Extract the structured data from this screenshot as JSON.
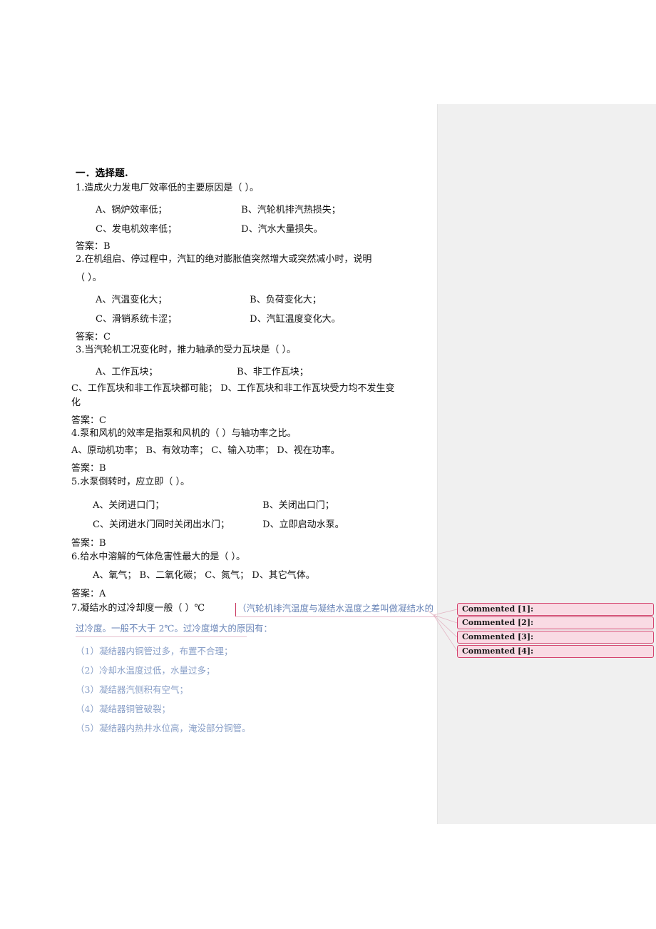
{
  "document": {
    "section_heading": "一．选择题.",
    "questions": [
      {
        "stem": "1.造成火力发电厂效率低的主要原因是（      ）。",
        "options_rows": [
          {
            "left": "A、锅炉效率低；",
            "right": "B、汽轮机排汽热损失；"
          },
          {
            "left": "C、发电机效率低；",
            "right": "D、汽水大量损失。"
          }
        ],
        "answer": "答案：B"
      },
      {
        "stem": "2.在机组启、停过程中，汽缸的绝对膨胀值突然增大或突然减小时，说明",
        "stem_cont": "（      ）。",
        "options_rows": [
          {
            "left": "A、汽温变化大；",
            "right": "B、负荷变化大；"
          },
          {
            "left": "C、滑销系统卡涩；",
            "right": "D、汽缸温度变化大。"
          }
        ],
        "answer": "答案：C"
      },
      {
        "stem": "3.当汽轮机工况变化时，推力轴承的受力瓦块是（      ）。",
        "options_rows": [
          {
            "left": "A、工作瓦块；",
            "right": "B、非工作瓦块；"
          }
        ],
        "wide_row": "C、工作瓦块和非工作瓦块都可能；    D、工作瓦块和非工作瓦块受力均不发生变",
        "wide_row_cont": "化",
        "answer": "答案：C"
      },
      {
        "stem": "4.泵和风机的效率是指泵和风机的（      ）与轴功率之比。",
        "wide_row": "A、原动机功率；      B、有效功率；      C、输入功率；    D、视在功率。",
        "answer": "答案：B"
      },
      {
        "stem": "5.水泵倒转时，应立即（      ）。",
        "options_rows": [
          {
            "left": "A、关闭进口门；",
            "right": "B、关闭出口门；"
          },
          {
            "left": "C、关闭进水门同时关闭出水门；",
            "right": "D、立即启动水泵。"
          }
        ],
        "answer": "答案：B"
      },
      {
        "stem": "6.给水中溶解的气体危害性最大的是（      ）。",
        "wide_row": "A、氧气；      B、二氧化碳；      C、氮气；      D、其它气体。",
        "answer": "答案：A"
      },
      {
        "stem": "7.凝结水的过冷却度一般（      ）℃",
        "revision": {
          "line1": "（汽轮机排汽温度与凝结水温度之差叫做凝结水的",
          "line2": "过冷度。一般不大于 2℃。过冷度增大的原因有：",
          "items": [
            "（1）凝结器内铜管过多，布置不合理；",
            "（2）冷却水温度过低，水量过多；",
            "（3）凝结器汽侧积有空气；",
            "（4）凝结器铜管破裂；",
            "（5）凝结器内热井水位高，淹没部分铜管。"
          ]
        }
      }
    ]
  },
  "comments": {
    "items": [
      {
        "label": "Commented [1]:"
      },
      {
        "label": "Commented [2]:"
      },
      {
        "label": "Commented [3]:"
      },
      {
        "label": "Commented [4]:"
      }
    ]
  },
  "colors": {
    "comment_fill": "#f9dbe4",
    "comment_border": "#d4456f",
    "pane_bg": "#f0f0f0",
    "revision_text": "#6b86b8",
    "caret": "#c8365e"
  }
}
